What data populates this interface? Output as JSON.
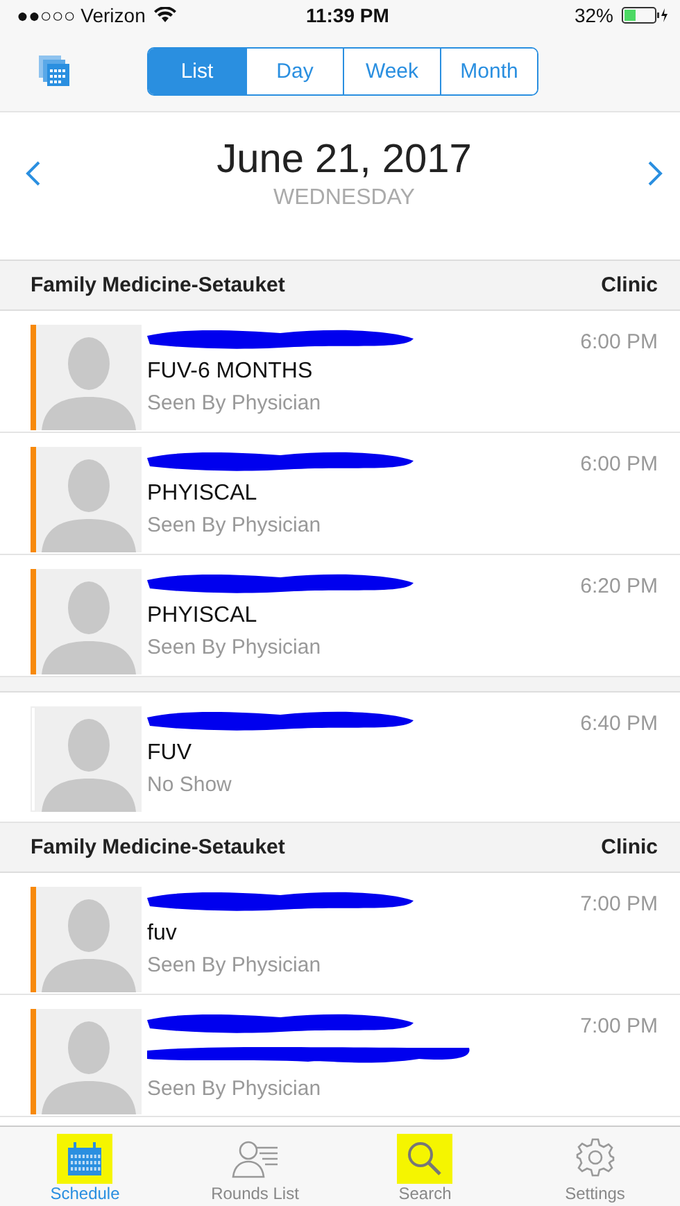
{
  "status_bar": {
    "carrier": "●●○○○ Verizon",
    "time": "11:39 PM",
    "battery": "32%"
  },
  "segments": [
    {
      "label": "List",
      "selected": true
    },
    {
      "label": "Day",
      "selected": false
    },
    {
      "label": "Week",
      "selected": false
    },
    {
      "label": "Month",
      "selected": false
    }
  ],
  "date": {
    "title": "June 21, 2017",
    "weekday": "WEDNESDAY"
  },
  "sections": [
    {
      "kind": "header",
      "title": "Family Medicine-Setauket",
      "type": "Clinic"
    },
    {
      "kind": "row",
      "flagged": true,
      "name_redacted": true,
      "visit": "FUV-6 MONTHS",
      "visit_redacted": false,
      "status": "Seen By Physician",
      "time": "6:00 PM"
    },
    {
      "kind": "row",
      "flagged": true,
      "name_redacted": true,
      "visit": "PHYISCAL",
      "visit_redacted": false,
      "status": "Seen By Physician",
      "time": "6:00 PM"
    },
    {
      "kind": "row",
      "flagged": true,
      "name_redacted": true,
      "visit": "PHYISCAL",
      "visit_redacted": false,
      "status": "Seen By Physician",
      "time": "6:20 PM"
    },
    {
      "kind": "strip"
    },
    {
      "kind": "row",
      "flagged": false,
      "name_redacted": true,
      "visit": "FUV",
      "visit_redacted": false,
      "status": "No Show",
      "time": "6:40 PM"
    },
    {
      "kind": "header",
      "title": "Family Medicine-Setauket",
      "type": "Clinic"
    },
    {
      "kind": "row",
      "flagged": true,
      "name_redacted": true,
      "visit": "fuv",
      "visit_redacted": false,
      "status": "Seen By Physician",
      "time": "7:00 PM"
    },
    {
      "kind": "row",
      "flagged": true,
      "name_redacted": true,
      "visit_redacted": true,
      "status": "Seen By Physician",
      "time": "7:00 PM"
    }
  ],
  "tabs": [
    {
      "label": "Schedule",
      "kind": "calendar",
      "selected": true,
      "highlighted": true
    },
    {
      "label": "Rounds List",
      "kind": "people",
      "selected": false,
      "highlighted": false
    },
    {
      "label": "Search",
      "kind": "search",
      "selected": false,
      "highlighted": true
    },
    {
      "label": "Settings",
      "kind": "gear",
      "selected": false,
      "highlighted": false
    }
  ]
}
